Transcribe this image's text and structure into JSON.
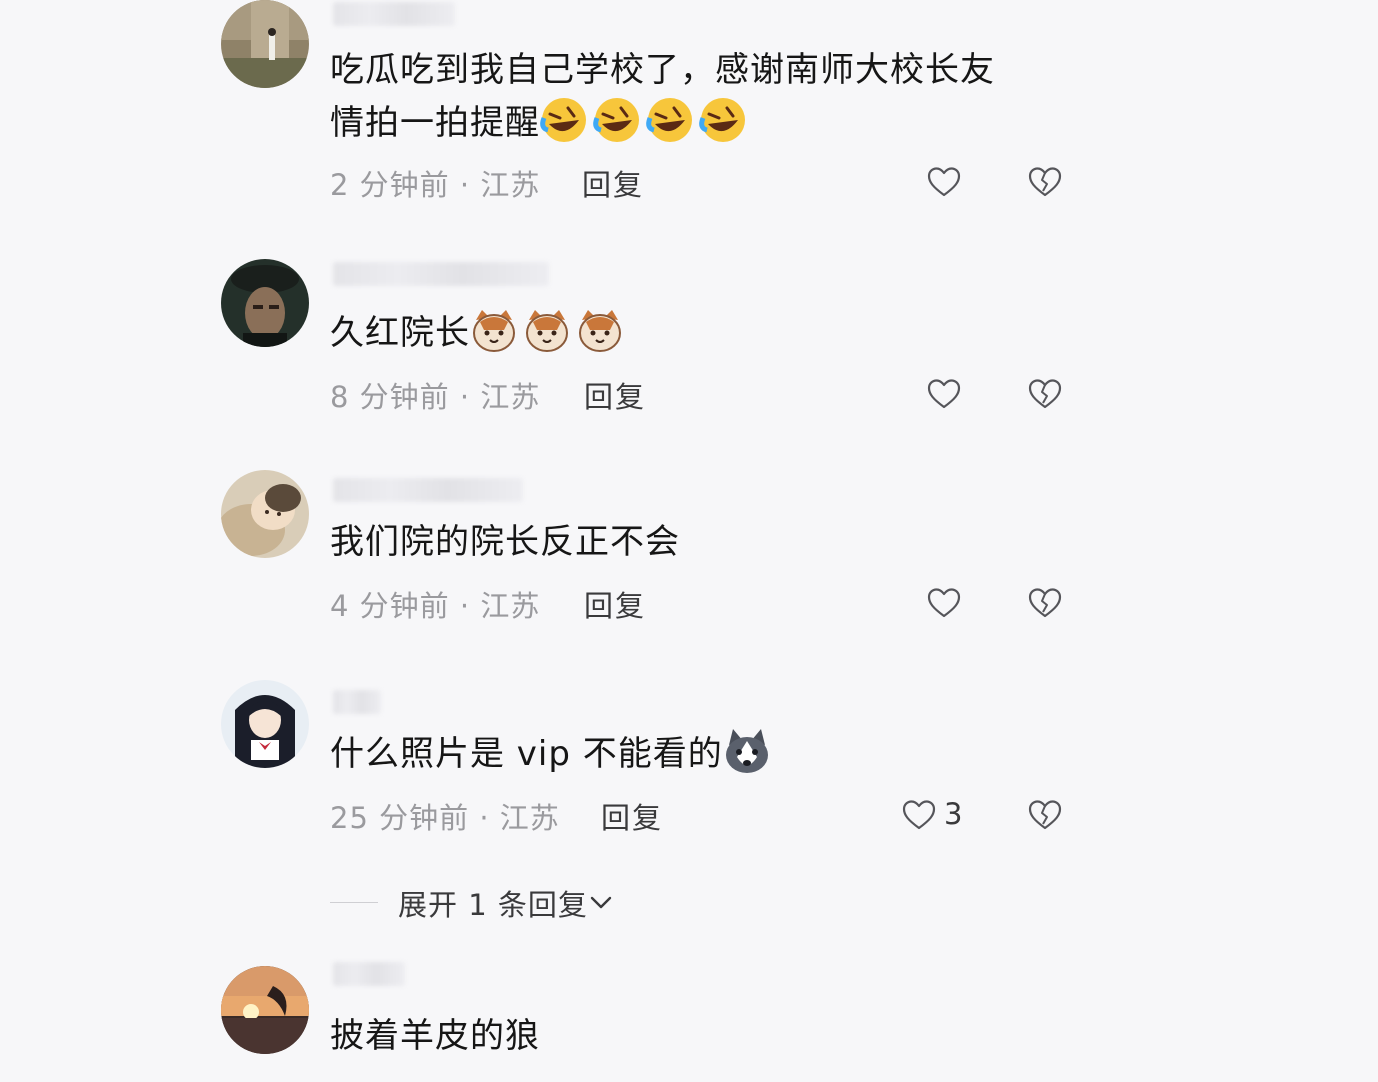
{
  "comments": [
    {
      "text_line1": "吃瓜吃到我自己学校了，感谢南师大校长友",
      "text_line2": "情拍一拍提醒",
      "emojis": [
        "rofl-emoji",
        "rofl-emoji",
        "rofl-emoji",
        "rofl-emoji"
      ],
      "time": "2 分钟前",
      "location": "江苏",
      "reply_label": "回复"
    },
    {
      "text": "久红院长",
      "emojis": [
        "cat-emoji",
        "cat-emoji",
        "cat-emoji"
      ],
      "time": "8 分钟前",
      "location": "江苏",
      "reply_label": "回复"
    },
    {
      "text": "我们院的院长反正不会",
      "time": "4 分钟前",
      "location": "江苏",
      "reply_label": "回复"
    },
    {
      "text": "什么照片是 vip 不能看的",
      "emojis": [
        "husky-emoji"
      ],
      "time": "25 分钟前",
      "location": "江苏",
      "reply_label": "回复",
      "like_count": "3"
    },
    {
      "text": "披着羊皮的狼"
    }
  ],
  "expand_replies": {
    "label": "展开 1 条回复"
  },
  "meta_separator": " · ",
  "icons": {
    "like": "heart-outline-icon",
    "dislike": "broken-heart-icon",
    "expand": "chevron-down-icon"
  },
  "colors": {
    "background": "#f7f7f9",
    "text": "#161616",
    "meta": "#9a9a9e",
    "action": "#3a3a3c"
  }
}
